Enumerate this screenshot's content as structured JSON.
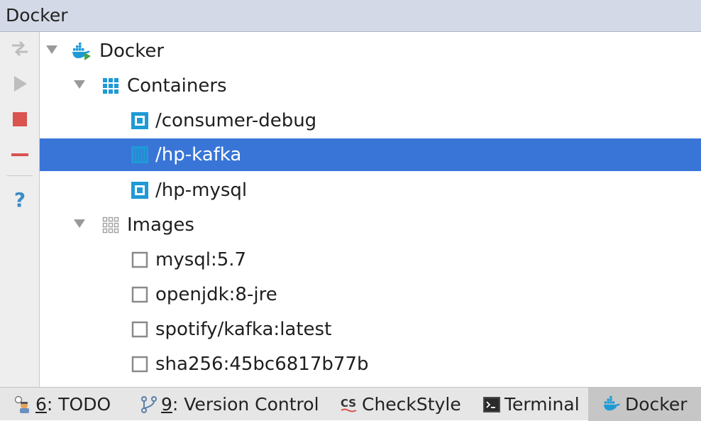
{
  "window": {
    "title": "Docker"
  },
  "toolbar": {
    "buttons": [
      {
        "icon": "deploy-icon",
        "enabled": false
      },
      {
        "icon": "run-icon",
        "enabled": false
      },
      {
        "icon": "stop-icon",
        "enabled": true
      },
      {
        "icon": "remove-icon",
        "enabled": true
      },
      {
        "icon": "help-icon",
        "enabled": true
      }
    ]
  },
  "tree": {
    "root": {
      "label": "Docker",
      "icon": "docker-icon"
    },
    "containers": {
      "label": "Containers",
      "items": [
        {
          "label": "/consumer-debug",
          "status": "running"
        },
        {
          "label": "/hp-kafka",
          "status": "stopped",
          "selected": true
        },
        {
          "label": "/hp-mysql",
          "status": "running"
        }
      ]
    },
    "images": {
      "label": "Images",
      "items": [
        {
          "label": "mysql:5.7"
        },
        {
          "label": "openjdk:8-jre"
        },
        {
          "label": "spotify/kafka:latest"
        },
        {
          "label": "sha256:45bc6817b77b"
        }
      ]
    }
  },
  "bottom_tabs": [
    {
      "num": "6",
      "rest": ": TODO",
      "icon": "todo-icon"
    },
    {
      "num": "9",
      "rest": ": Version Control",
      "icon": "version-control-icon"
    },
    {
      "num": "",
      "rest": "CheckStyle",
      "icon": "checkstyle-icon"
    },
    {
      "num": "",
      "rest": "Terminal",
      "icon": "terminal-icon"
    },
    {
      "num": "",
      "rest": "Docker",
      "icon": "docker-icon",
      "active": true
    }
  ],
  "colors": {
    "selection": "#3875d7",
    "container_blue": "#1e9ad6",
    "stop_red": "#d9534f"
  }
}
